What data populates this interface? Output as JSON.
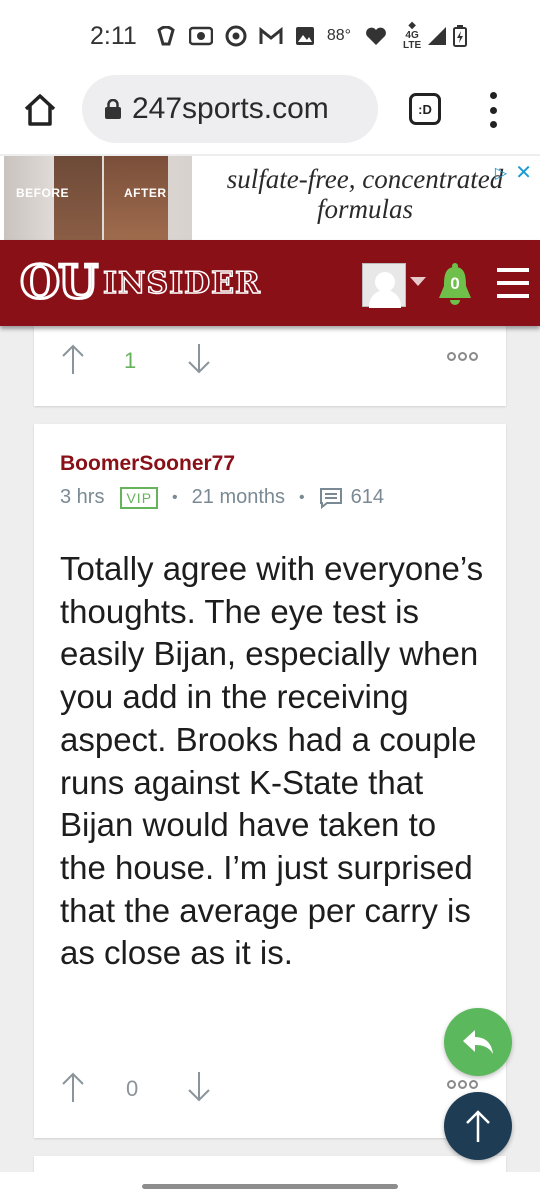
{
  "status_bar": {
    "time": "2:11",
    "temperature": "88°",
    "network": "4G LTE"
  },
  "browser": {
    "url": "247sports.com",
    "tabs_label": ":D"
  },
  "ad": {
    "before_label": "BEFORE",
    "after_label": "AFTER",
    "text": "sulfate-free, concentrated formulas"
  },
  "site": {
    "logo_primary": "OU",
    "logo_secondary": "INSIDER",
    "notification_count": "0"
  },
  "posts": [
    {
      "vote_count": "1"
    },
    {
      "author": "BoomerSooner77",
      "time": "3 hrs",
      "badge": "VIP",
      "member_duration": "21 months",
      "post_count": "614",
      "body": "Totally agree with everyone’s thoughts. The eye test is easily Bijan, especially when you add in the receiving aspect. Brooks had a couple runs against K-State that Bijan would have taken to the house. I’m just surprised that the average per carry is as close as it is.",
      "vote_count": "0"
    }
  ],
  "colors": {
    "brand": "#8a1018",
    "upvote_active": "#65b35a",
    "reply_fab": "#5cb85c",
    "top_fab": "#1e3c54"
  }
}
